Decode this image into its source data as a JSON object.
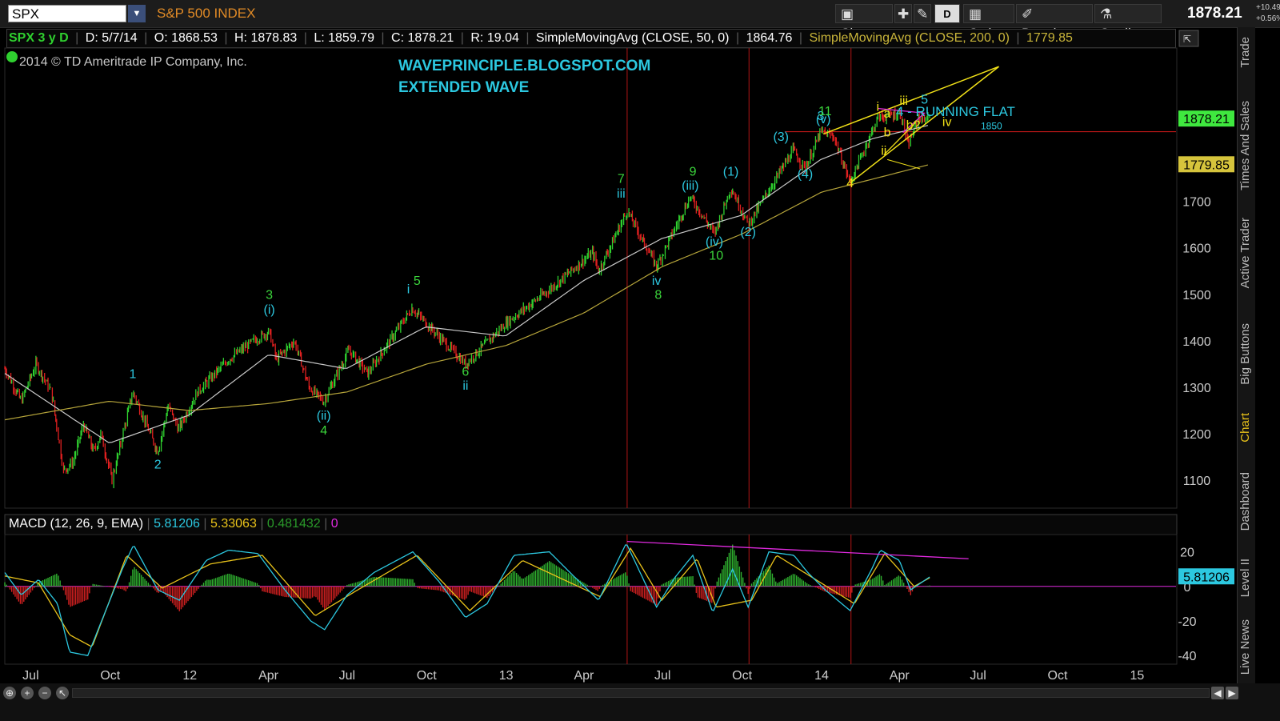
{
  "toolbar": {
    "symbol": "SPX",
    "symbol_name": "S&P 500 INDEX",
    "share_label": "Share",
    "period_badge": "D",
    "style_label": "Style",
    "drawings_label": "Drawings",
    "studies_label": "Studies",
    "last_price": "1878.21",
    "change_abs": "+10.49",
    "change_pct": "+0.56%"
  },
  "infobar": {
    "period": "SPX 3 y D",
    "date": "D: 5/7/14",
    "open": "O: 1868.53",
    "high": "H: 1878.83",
    "low": "L: 1859.79",
    "close": "C: 1878.21",
    "range": "R: 19.04",
    "sma50_label": "SimpleMovingAvg (CLOSE, 50, 0)",
    "sma50_value": "1864.76",
    "sma200_label": "SimpleMovingAvg (CLOSE, 200, 0)",
    "sma200_value": "1779.85"
  },
  "copyright": "2014 © TD Ameritrade IP Company, Inc.",
  "annotations": {
    "blog": "WAVEPRINCIPLE.BLOGSPOT.COM",
    "extended": "EXTENDED WAVE",
    "running_flat": "4 - RUNNING FLAT"
  },
  "macd_header": {
    "label": "MACD (12, 26, 9, EMA)",
    "value": "5.81206",
    "avg": "5.33063",
    "diff": "0.481432",
    "zero": "0"
  },
  "side_tabs": [
    "Trade",
    "Times And Sales",
    "Active Trader",
    "Big Buttons",
    "Chart",
    "Dashboard",
    "Level II",
    "Live News"
  ],
  "colors": {
    "price_up": "#2fd02f",
    "price_down": "#e02020",
    "sma50": "#c8c8c8",
    "sma200": "#b5a43a",
    "wave_green": "#3bd63b",
    "wave_cyan": "#2cc8e0",
    "wave_yellow": "#f2e218",
    "vertical_lines": "#b01515",
    "macd_line": "#2cc8e0",
    "macd_signal": "#e8c21a",
    "divergence": "#e02adf"
  },
  "chart_data": [
    {
      "type": "line",
      "title": "SPX 3 y D",
      "series": [
        {
          "name": "SPX",
          "x": [
            "2011-06-01",
            "2011-06-20",
            "2011-07-07",
            "2011-07-25",
            "2011-08-08",
            "2011-08-19",
            "2011-08-31",
            "2011-09-12",
            "2011-09-20",
            "2011-10-03",
            "2011-10-27",
            "2011-11-25",
            "2011-12-07",
            "2011-12-19",
            "2012-01-10",
            "2012-02-15",
            "2012-03-15",
            "2012-04-02",
            "2012-04-10",
            "2012-05-01",
            "2012-05-18",
            "2012-06-04",
            "2012-07-03",
            "2012-07-25",
            "2012-09-14",
            "2012-11-15",
            "2013-01-02",
            "2013-02-20",
            "2013-04-11",
            "2013-04-18",
            "2013-05-21",
            "2013-06-24",
            "2013-08-02",
            "2013-08-30",
            "2013-09-18",
            "2013-10-08",
            "2013-11-29",
            "2013-12-13",
            "2013-12-31",
            "2014-01-15",
            "2014-02-03",
            "2014-03-07",
            "2014-04-02",
            "2014-04-11",
            "2014-04-23",
            "2014-05-07"
          ],
          "values": [
            1340,
            1270,
            1350,
            1290,
            1120,
            1140,
            1220,
            1160,
            1200,
            1100,
            1290,
            1160,
            1260,
            1210,
            1290,
            1360,
            1400,
            1420,
            1360,
            1400,
            1300,
            1270,
            1380,
            1330,
            1470,
            1350,
            1440,
            1510,
            1590,
            1550,
            1680,
            1560,
            1710,
            1630,
            1730,
            1650,
            1810,
            1770,
            1850,
            1840,
            1740,
            1880,
            1890,
            1820,
            1880,
            1878
          ]
        },
        {
          "name": "SMA 50",
          "x": [
            "2011-06-01",
            "2011-09-30",
            "2011-12-31",
            "2012-04-01",
            "2012-06-30",
            "2012-09-30",
            "2012-12-31",
            "2013-04-01",
            "2013-06-30",
            "2013-09-30",
            "2013-12-31",
            "2014-03-01",
            "2014-05-07"
          ],
          "values": [
            1330,
            1180,
            1240,
            1370,
            1340,
            1430,
            1410,
            1530,
            1620,
            1670,
            1790,
            1835,
            1864.76
          ]
        },
        {
          "name": "SMA 200",
          "x": [
            "2011-06-01",
            "2011-09-30",
            "2011-12-31",
            "2012-04-01",
            "2012-07-01",
            "2012-10-01",
            "2013-01-01",
            "2013-04-01",
            "2013-07-01",
            "2013-10-01",
            "2014-01-01",
            "2014-05-07"
          ],
          "values": [
            1230,
            1270,
            1250,
            1265,
            1290,
            1350,
            1390,
            1460,
            1560,
            1630,
            1720,
            1779.85
          ]
        }
      ],
      "ylim": [
        1040,
        2030
      ],
      "y_ticks": [
        1100,
        1200,
        1300,
        1400,
        1500,
        1600,
        1700
      ],
      "x_tick_labels": [
        "Jul",
        "Oct",
        "12",
        "Apr",
        "Jul",
        "Oct",
        "13",
        "Apr",
        "Jul",
        "Oct",
        "14",
        "Apr",
        "Jul",
        "Oct",
        "15"
      ],
      "x_tick_dates": [
        "2011-07-01",
        "2011-10-01",
        "2012-01-01",
        "2012-04-01",
        "2012-07-01",
        "2012-10-01",
        "2013-01-01",
        "2013-04-01",
        "2013-07-01",
        "2013-10-01",
        "2014-01-01",
        "2014-04-01",
        "2014-07-01",
        "2014-10-01",
        "2015-01-01"
      ],
      "price_labels": [
        "1878.21",
        "1779.85"
      ],
      "horizontal_line": {
        "value": 1850,
        "label": "1850"
      },
      "vertical_lines": [
        "2013-05-21",
        "2013-10-09",
        "2014-02-04"
      ],
      "wave_labels": [
        {
          "text": "1",
          "date": "2011-10-27",
          "value": 1320,
          "color": "cyan"
        },
        {
          "text": "2",
          "date": "2011-11-25",
          "value": 1125,
          "color": "cyan"
        },
        {
          "text": "3",
          "date": "2012-04-02",
          "value": 1490,
          "color": "green"
        },
        {
          "text": "(i)",
          "date": "2012-04-02",
          "value": 1458,
          "color": "cyan"
        },
        {
          "text": "(ii)",
          "date": "2012-06-04",
          "value": 1230,
          "color": "cyan"
        },
        {
          "text": "4",
          "date": "2012-06-04",
          "value": 1198,
          "color": "green"
        },
        {
          "text": "i",
          "date": "2012-09-10",
          "value": 1502,
          "color": "cyan"
        },
        {
          "text": "5",
          "date": "2012-09-20",
          "value": 1520,
          "color": "green"
        },
        {
          "text": "6",
          "date": "2012-11-15",
          "value": 1325,
          "color": "green"
        },
        {
          "text": "ii",
          "date": "2012-11-15",
          "value": 1295,
          "color": "cyan"
        },
        {
          "text": "7",
          "date": "2013-05-14",
          "value": 1740,
          "color": "green"
        },
        {
          "text": "iii",
          "date": "2013-05-14",
          "value": 1708,
          "color": "cyan"
        },
        {
          "text": "iv",
          "date": "2013-06-24",
          "value": 1520,
          "color": "cyan"
        },
        {
          "text": "8",
          "date": "2013-06-26",
          "value": 1490,
          "color": "green"
        },
        {
          "text": "9",
          "date": "2013-08-05",
          "value": 1755,
          "color": "green"
        },
        {
          "text": "(iii)",
          "date": "2013-08-02",
          "value": 1725,
          "color": "cyan"
        },
        {
          "text": "(iv)",
          "date": "2013-08-30",
          "value": 1605,
          "color": "cyan"
        },
        {
          "text": "10",
          "date": "2013-09-01",
          "value": 1575,
          "color": "green"
        },
        {
          "text": "(1)",
          "date": "2013-09-18",
          "value": 1755,
          "color": "cyan"
        },
        {
          "text": "(2)",
          "date": "2013-10-08",
          "value": 1625,
          "color": "cyan"
        },
        {
          "text": "(3)",
          "date": "2013-11-15",
          "value": 1830,
          "color": "cyan"
        },
        {
          "text": "(4)",
          "date": "2013-12-13",
          "value": 1750,
          "color": "cyan"
        },
        {
          "text": "3",
          "date": "2013-12-31",
          "value": 1875,
          "color": "cyan"
        },
        {
          "text": "(v)",
          "date": "2014-01-03",
          "value": 1868,
          "color": "cyan"
        },
        {
          "text": "11",
          "date": "2014-01-05",
          "value": 1885,
          "color": "green"
        },
        {
          "text": "4",
          "date": "2014-02-03",
          "value": 1730,
          "color": "yellow"
        },
        {
          "text": "i",
          "date": "2014-03-07",
          "value": 1895,
          "color": "yellow"
        },
        {
          "text": "ii",
          "date": "2014-03-14",
          "value": 1800,
          "color": "yellow"
        },
        {
          "text": "iii",
          "date": "2014-04-06",
          "value": 1908,
          "color": "yellow"
        },
        {
          "text": "5",
          "date": "2014-04-30",
          "value": 1910,
          "color": "cyan"
        },
        {
          "text": "iv",
          "date": "2014-05-26",
          "value": 1862,
          "color": "yellow"
        },
        {
          "text": "a",
          "date": "2014-03-18",
          "value": 1880,
          "color": "yellow"
        },
        {
          "text": "b",
          "date": "2014-03-18",
          "value": 1840,
          "color": "yellow"
        },
        {
          "text": "b?",
          "date": "2014-04-17",
          "value": 1855,
          "color": "yellow"
        }
      ]
    },
    {
      "type": "line",
      "title": "MACD (12, 26, 9, EMA)",
      "series": [
        {
          "name": "MACD",
          "x": [
            "2011-06-01",
            "2011-06-20",
            "2011-07-10",
            "2011-08-01",
            "2011-08-15",
            "2011-09-05",
            "2011-09-25",
            "2011-10-15",
            "2011-10-28",
            "2011-11-25",
            "2011-12-20",
            "2012-01-20",
            "2012-02-15",
            "2012-03-20",
            "2012-04-20",
            "2012-05-20",
            "2012-06-05",
            "2012-07-01",
            "2012-08-01",
            "2012-09-15",
            "2012-10-15",
            "2012-11-15",
            "2012-12-10",
            "2013-01-10",
            "2013-02-20",
            "2013-03-20",
            "2013-04-18",
            "2013-05-20",
            "2013-06-24",
            "2013-07-15",
            "2013-08-05",
            "2013-08-28",
            "2013-09-20",
            "2013-10-08",
            "2013-11-01",
            "2013-11-30",
            "2013-12-16",
            "2014-01-05",
            "2014-02-03",
            "2014-02-28",
            "2014-03-10",
            "2014-04-01",
            "2014-04-14",
            "2014-05-07"
          ],
          "values": [
            8,
            -5,
            4,
            -10,
            -38,
            -40,
            -15,
            10,
            24,
            -2,
            -8,
            15,
            21,
            19,
            -2,
            -20,
            -25,
            -5,
            8,
            20,
            3,
            -18,
            -10,
            18,
            20,
            6,
            -8,
            25,
            -12,
            5,
            18,
            -15,
            10,
            -12,
            20,
            18,
            8,
            -2,
            -14,
            10,
            21,
            15,
            -2,
            5.8
          ]
        },
        {
          "name": "Signal",
          "x": [
            "2011-06-01",
            "2011-07-10",
            "2011-08-15",
            "2011-09-10",
            "2011-10-20",
            "2011-11-30",
            "2012-01-25",
            "2012-03-25",
            "2012-05-25",
            "2012-07-10",
            "2012-09-20",
            "2012-11-20",
            "2013-01-20",
            "2013-04-20",
            "2013-05-25",
            "2013-06-30",
            "2013-08-10",
            "2013-09-01",
            "2013-10-12",
            "2013-11-10",
            "2014-01-10",
            "2014-02-08",
            "2014-03-15",
            "2014-04-18",
            "2014-05-07"
          ],
          "values": [
            6,
            2,
            -28,
            -35,
            18,
            -1,
            13,
            18,
            -17,
            -3,
            18,
            -14,
            15,
            -6,
            22,
            -8,
            16,
            -12,
            -8,
            18,
            -1,
            -10,
            19,
            0,
            5.3
          ]
        }
      ],
      "ylim": [
        -45,
        30
      ],
      "y_ticks": [
        -40,
        -20,
        0,
        20
      ],
      "divergence_line": {
        "from": {
          "date": "2013-05-21",
          "value": 26
        },
        "to": {
          "date": "2014-06-20",
          "value": 16
        }
      }
    }
  ]
}
